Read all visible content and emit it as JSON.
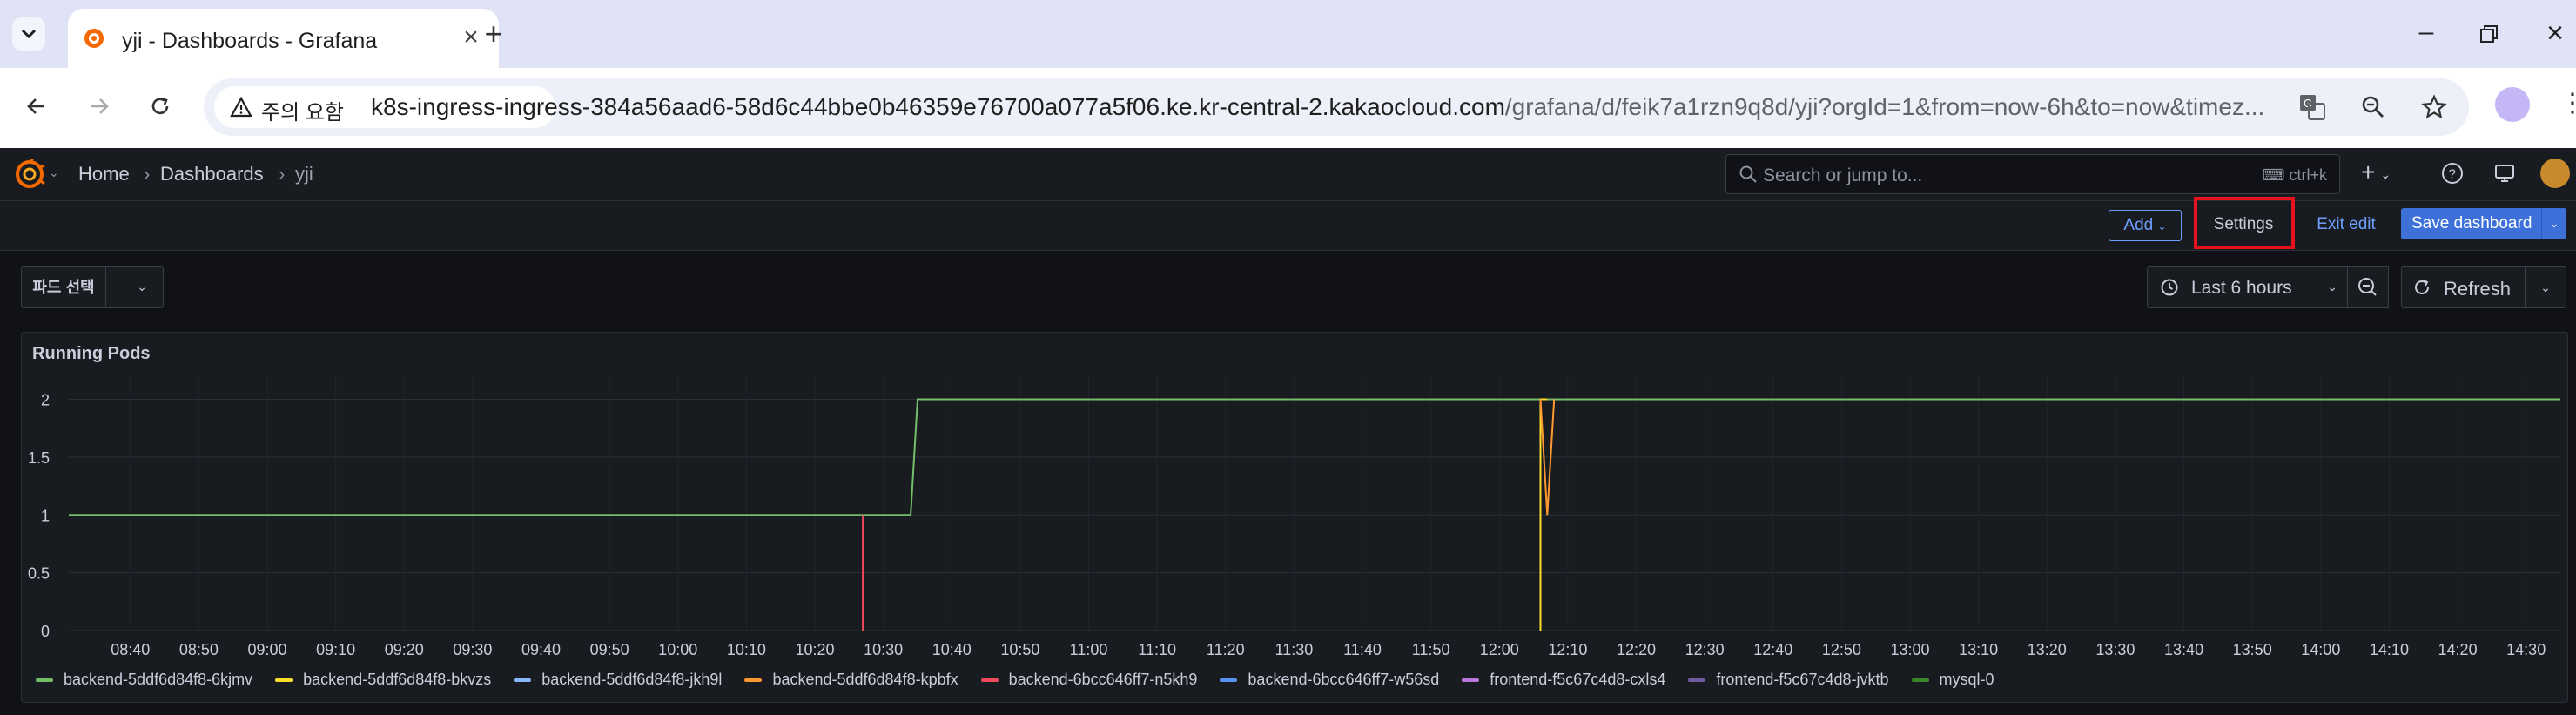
{
  "browser": {
    "tab_title": "yji - Dashboards - Grafana",
    "security_label": "주의 요함",
    "url_host": "k8s-ingress-ingress-384a56aad6-58d6c44bbe0b46359e76700a077a5f06.ke.kr-central-2.kakaocloud.com",
    "url_path": "/grafana/d/feik7a1rzn9q8d/yji?orgId=1&from=now-6h&to=now&timez..."
  },
  "grafana": {
    "breadcrumbs": {
      "home": "Home",
      "dashboards": "Dashboards",
      "current": "yji"
    },
    "search_placeholder": "Search or jump to...",
    "search_shortcut": "ctrl+k",
    "add_label": "Add",
    "settings_label": "Settings",
    "exit_edit_label": "Exit edit",
    "save_label": "Save dashboard",
    "variable_label": "파드 선택",
    "time_range": "Last 6 hours",
    "refresh_label": "Refresh",
    "panel_title": "Running Pods"
  },
  "colors": {
    "accent_blue": "#6e9fff",
    "primary_button": "#3d71d9",
    "highlight": "#e8121e"
  },
  "chart_data": {
    "type": "line",
    "title": "Running Pods",
    "xlabel": "",
    "ylabel": "",
    "ylim": [
      0,
      2.2
    ],
    "yticks": [
      0,
      0.5,
      1,
      1.5,
      2
    ],
    "ytick_labels": [
      "0",
      "0.5",
      "1",
      "1.5",
      "2"
    ],
    "xlim": [
      "08:31",
      "14:35"
    ],
    "xticks": [
      "08:40",
      "08:50",
      "09:00",
      "09:10",
      "09:20",
      "09:30",
      "09:40",
      "09:50",
      "10:00",
      "10:10",
      "10:20",
      "10:30",
      "10:40",
      "10:50",
      "11:00",
      "11:10",
      "11:20",
      "11:30",
      "11:40",
      "11:50",
      "12:00",
      "12:10",
      "12:20",
      "12:30",
      "12:40",
      "12:50",
      "13:00",
      "13:10",
      "13:20",
      "13:30",
      "13:40",
      "13:50",
      "14:00",
      "14:10",
      "14:20",
      "14:30"
    ],
    "grid": true,
    "legend_position": "bottom",
    "series": [
      {
        "name": "backend-5ddf6d84f8-6kjmv",
        "color": "#73bf69",
        "points": [
          [
            "08:31",
            1
          ],
          [
            "10:34",
            1
          ],
          [
            "10:35",
            2
          ],
          [
            "14:35",
            2
          ]
        ]
      },
      {
        "name": "backend-5ddf6d84f8-bkvzs",
        "color": "#fade2a",
        "points": [
          [
            "12:06",
            0
          ],
          [
            "12:06",
            2
          ],
          [
            "12:07",
            2
          ]
        ]
      },
      {
        "name": "backend-5ddf6d84f8-jkh9l",
        "color": "#8ab8ff",
        "points": []
      },
      {
        "name": "backend-5ddf6d84f8-kpbfx",
        "color": "#ff9830",
        "points": [
          [
            "12:06",
            2
          ],
          [
            "12:07",
            1
          ],
          [
            "12:08",
            2
          ]
        ]
      },
      {
        "name": "backend-6bcc646ff7-n5kh9",
        "color": "#f2495c",
        "points": [
          [
            "10:27",
            0
          ],
          [
            "10:27",
            1
          ]
        ]
      },
      {
        "name": "backend-6bcc646ff7-w56sd",
        "color": "#5794f2",
        "points": []
      },
      {
        "name": "frontend-f5c67c4d8-cxls4",
        "color": "#b877d9",
        "points": []
      },
      {
        "name": "frontend-f5c67c4d8-jvktb",
        "color": "#705da0",
        "points": []
      },
      {
        "name": "mysql-0",
        "color": "#37872d",
        "points": []
      }
    ]
  }
}
